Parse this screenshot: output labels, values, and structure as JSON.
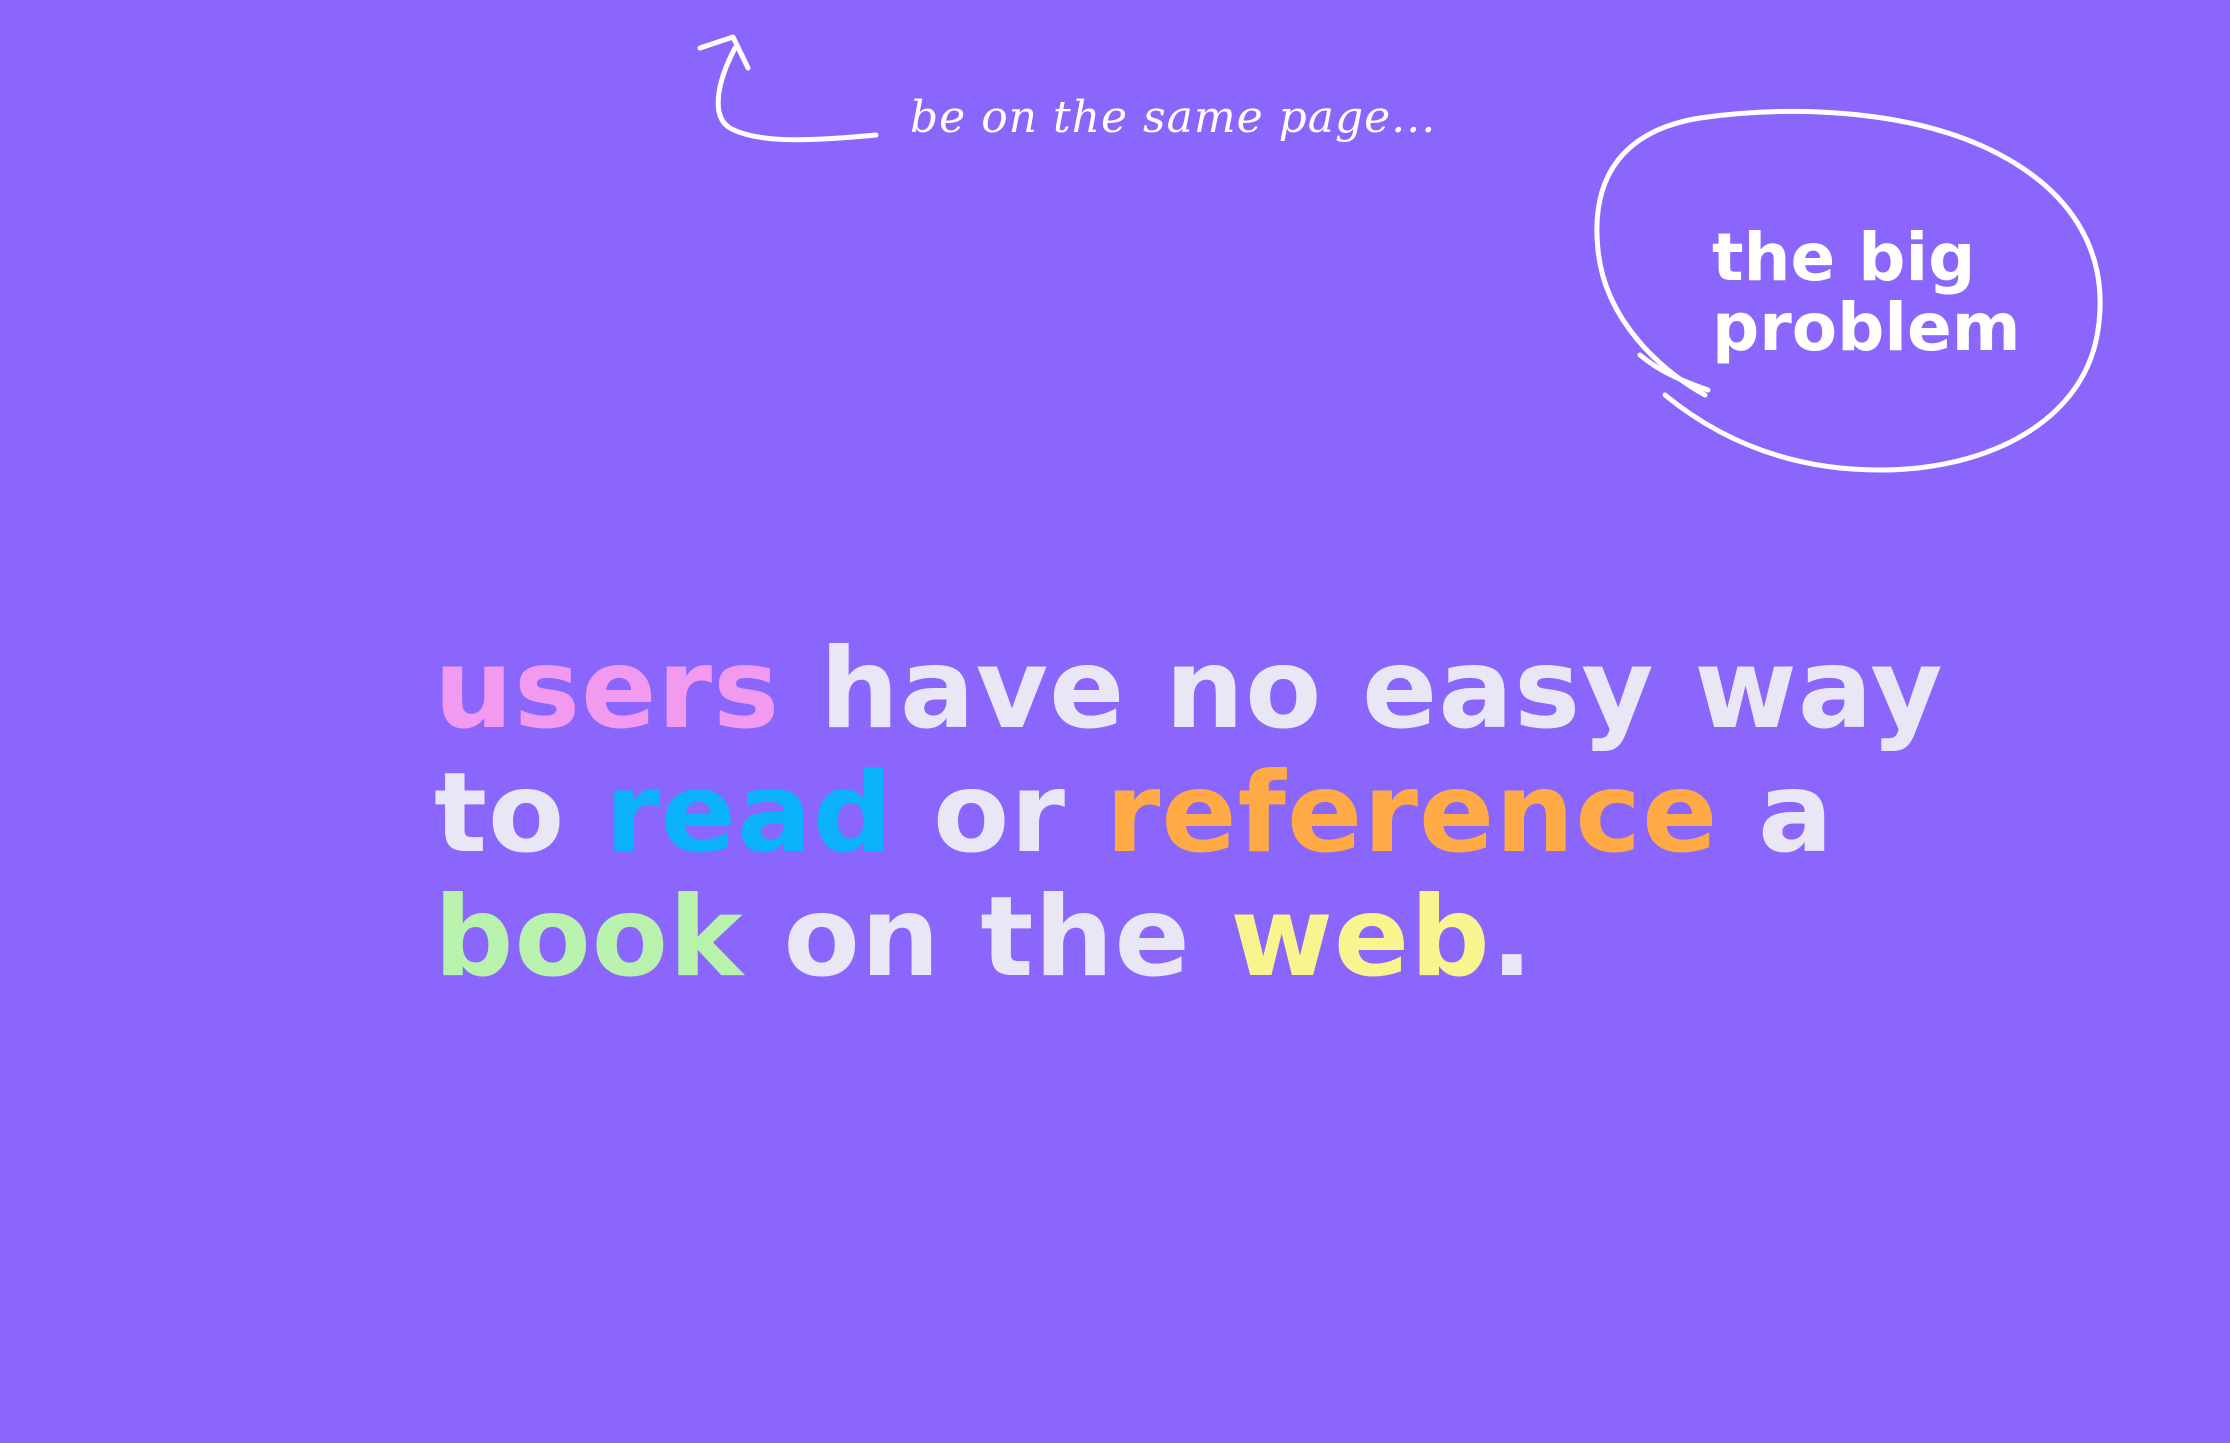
{
  "slide": {
    "background": "#8b66fd",
    "note": "be on the same page...",
    "bubble": {
      "line1": "the big",
      "line2": "problem"
    },
    "headline": {
      "base_color": "#e9e7f5",
      "lines": [
        [
          {
            "text": "users",
            "color": "#f29af0"
          },
          {
            "text": " have no easy way",
            "color": null
          }
        ],
        [
          {
            "text": "to ",
            "color": null
          },
          {
            "text": "read",
            "color": "#0bb2fa"
          },
          {
            "text": " or ",
            "color": null
          },
          {
            "text": "reference",
            "color": "#ffaa44"
          },
          {
            "text": " a",
            "color": null
          }
        ],
        [
          {
            "text": "book",
            "color": "#b8f2ad"
          },
          {
            "text": " on the ",
            "color": null
          },
          {
            "text": "web",
            "color": "#f8f58f"
          },
          {
            "text": ".",
            "color": null
          }
        ]
      ]
    }
  }
}
